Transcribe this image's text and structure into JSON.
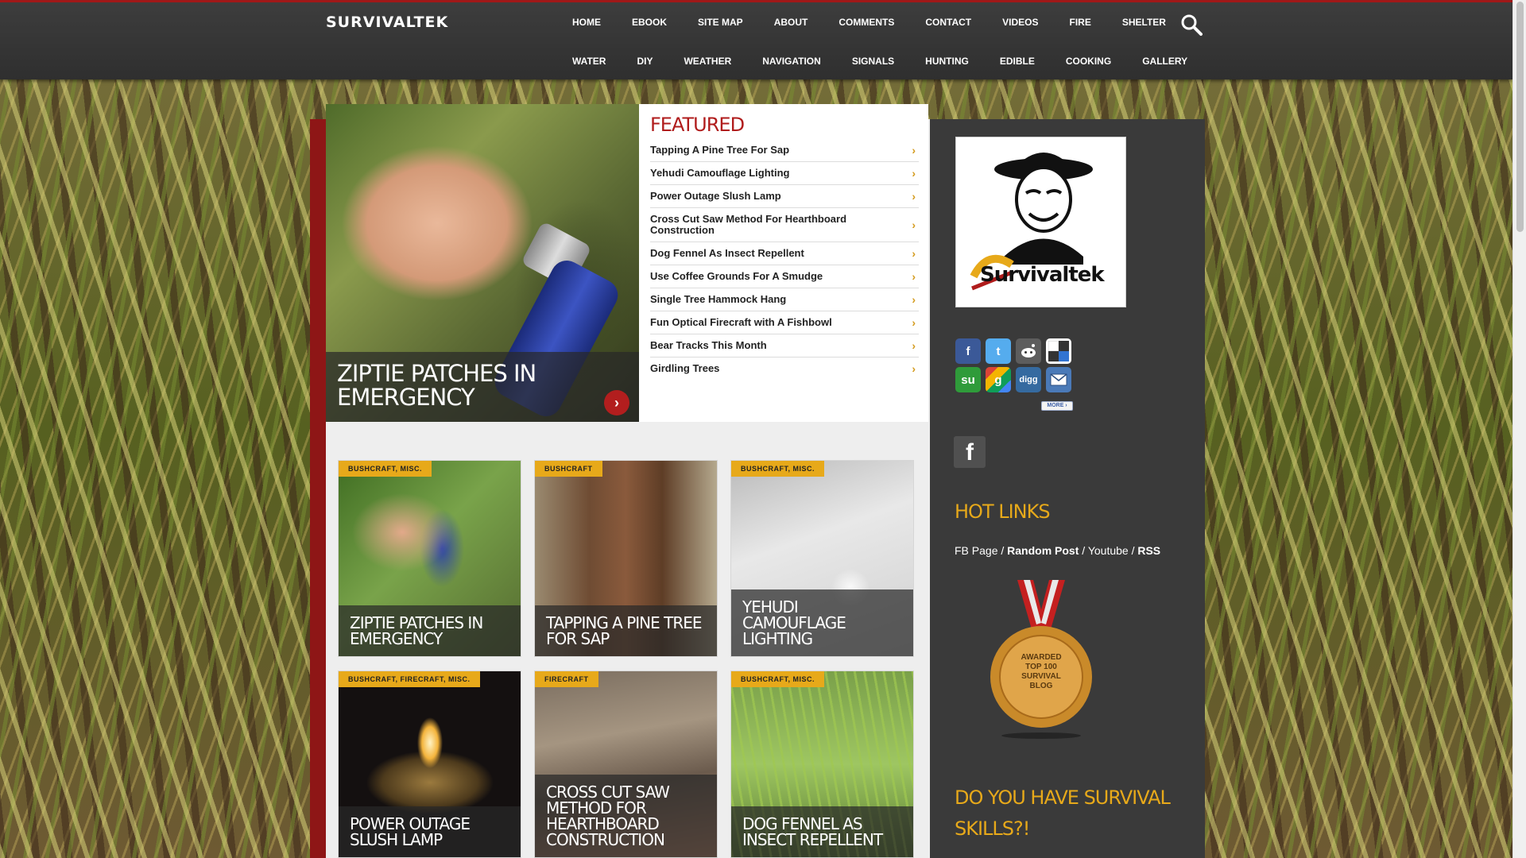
{
  "header": {
    "logo": "SURVIVALTEK",
    "nav_row1": [
      "HOME",
      "EBOOK",
      "SITE MAP",
      "ABOUT",
      "COMMENTS",
      "CONTACT",
      "VIDEOS",
      "FIRE",
      "SHELTER"
    ],
    "nav_row2": [
      "WATER",
      "DIY",
      "WEATHER",
      "NAVIGATION",
      "SIGNALS",
      "HUNTING",
      "EDIBLE",
      "COOKING",
      "GALLERY"
    ]
  },
  "hero": {
    "title": "ZIPTIE PATCHES IN EMERGENCY",
    "arrow": "›"
  },
  "featured": {
    "title": "FEATURED",
    "items": [
      "Tapping A Pine Tree For Sap",
      "Yehudi Camouflage Lighting",
      "Power Outage Slush Lamp",
      "Cross Cut Saw Method For Hearthboard Construction",
      "Dog Fennel As Insect Repellent",
      "Use Coffee Grounds For A Smudge",
      "Single Tree Hammock Hang",
      "Fun Optical Firecraft with A Fishbowl",
      "Bear Tracks This Month",
      "Girdling Trees"
    ]
  },
  "cards": [
    {
      "tag": "BUSHCRAFT, MISC.",
      "title": "ZIPTIE PATCHES IN EMERGENCY"
    },
    {
      "tag": "BUSHCRAFT",
      "title": "TAPPING A PINE TREE FOR SAP"
    },
    {
      "tag": "BUSHCRAFT, MISC.",
      "title": "YEHUDI CAMOUFLAGE LIGHTING"
    },
    {
      "tag": "BUSHCRAFT, FIRECRAFT, MISC.",
      "title": "POWER OUTAGE SLUSH LAMP"
    },
    {
      "tag": "FIRECRAFT",
      "title": "CROSS CUT SAW METHOD FOR HEARTHBOARD CONSTRUCTION"
    },
    {
      "tag": "BUSHCRAFT, MISC.",
      "title": "DOG FENNEL AS INSECT REPELLENT"
    }
  ],
  "sidebar": {
    "logo_text": "Survivaltek",
    "social": {
      "facebook": "f",
      "twitter": "t",
      "stumbleupon": "su",
      "google": "g",
      "digg": "digg",
      "more": "MORE ›"
    },
    "fb_square": "f",
    "hotlinks_title": "HOT LINKS",
    "hotlinks": {
      "fb_page": "FB Page",
      "random_post": "Random Post",
      "youtube": "Youtube",
      "rss": "RSS",
      "separator": " / "
    },
    "badge": {
      "line1": "AWARDED",
      "line2": "TOP 100",
      "line3": "SURVIVAL",
      "line4": "BLOG"
    },
    "skills_title": "DO YOU HAVE SURVIVAL SKILLS?!"
  },
  "colors": {
    "accent_red": "#b01c1c",
    "accent_gold": "#e7a91a",
    "topbar": "#353535",
    "sidebar": "#3a3a3a"
  }
}
